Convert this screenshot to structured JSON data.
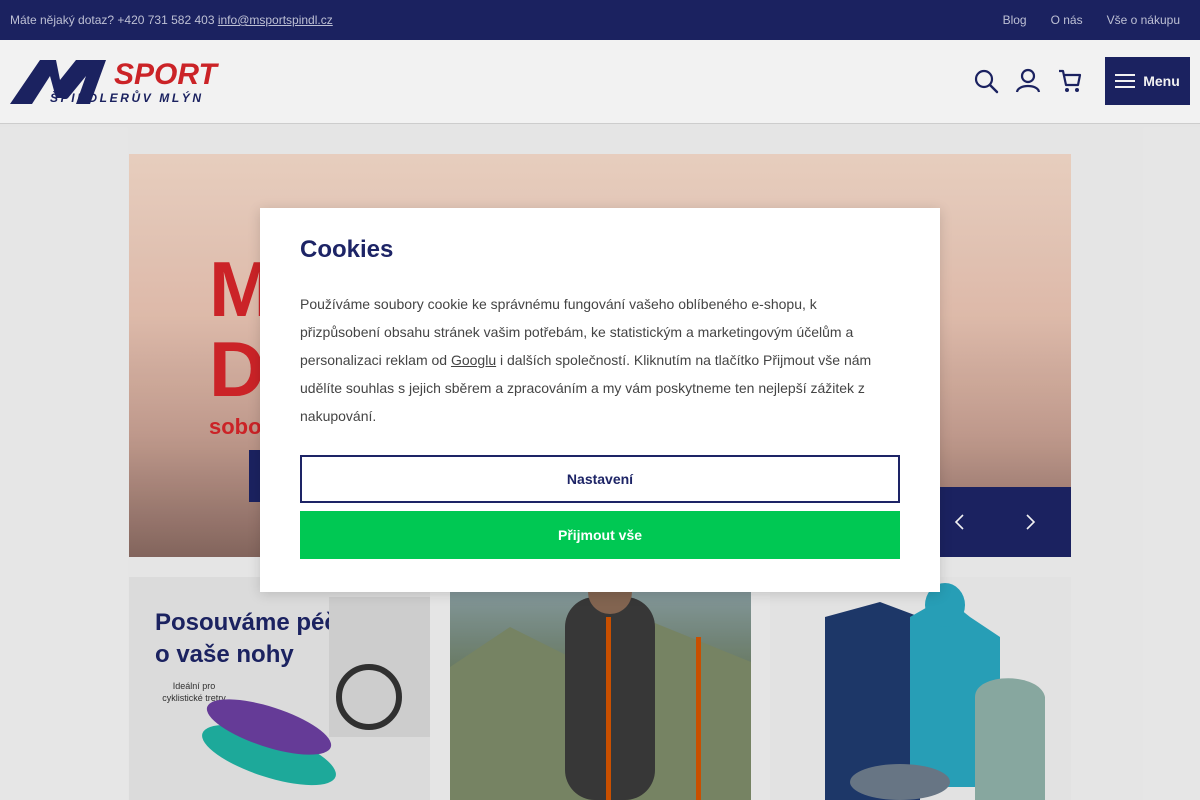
{
  "topbar": {
    "question": "Máte nějaký dotaz? +420 731 582 403",
    "email": "info@msportspindl.cz",
    "links": [
      "Blog",
      "O nás",
      "Vše o nákupu"
    ]
  },
  "header": {
    "logo_sport": "SPORT",
    "logo_city": "ŠPINDLERŮV MLÝN",
    "menu_label": "Menu",
    "icons": [
      "search-icon",
      "user-icon",
      "cart-icon"
    ]
  },
  "banner": {
    "headline_visible": "M\nD",
    "sub_visible": "sobo"
  },
  "tiles": {
    "tile1_heading": "Posouváme péči\no vaše nohy",
    "tile1_note": "Ideální pro cyklistické tretry"
  },
  "cookies": {
    "title": "Cookies",
    "text_before_link": "Používáme soubory cookie ke správnému fungování vašeho oblíbeného e-shopu, k přizpůsobení obsahu stránek vašim potřebám, ke statistickým a marketingovým účelům a personalizaci reklam od ",
    "link": "Googlu",
    "text_after_link": " i dalších společností. Kliknutím na tlačítko Přijmout vše nám udělíte souhlas s jejich sběrem a zpracováním a my vám poskytneme ten nejlepší zážitek z nakupování.",
    "settings_label": "Nastavení",
    "accept_label": "Přijmout vše"
  },
  "colors": {
    "brand_navy": "#1d2466",
    "brand_red": "#d6252a",
    "accept_green": "#00c853"
  }
}
